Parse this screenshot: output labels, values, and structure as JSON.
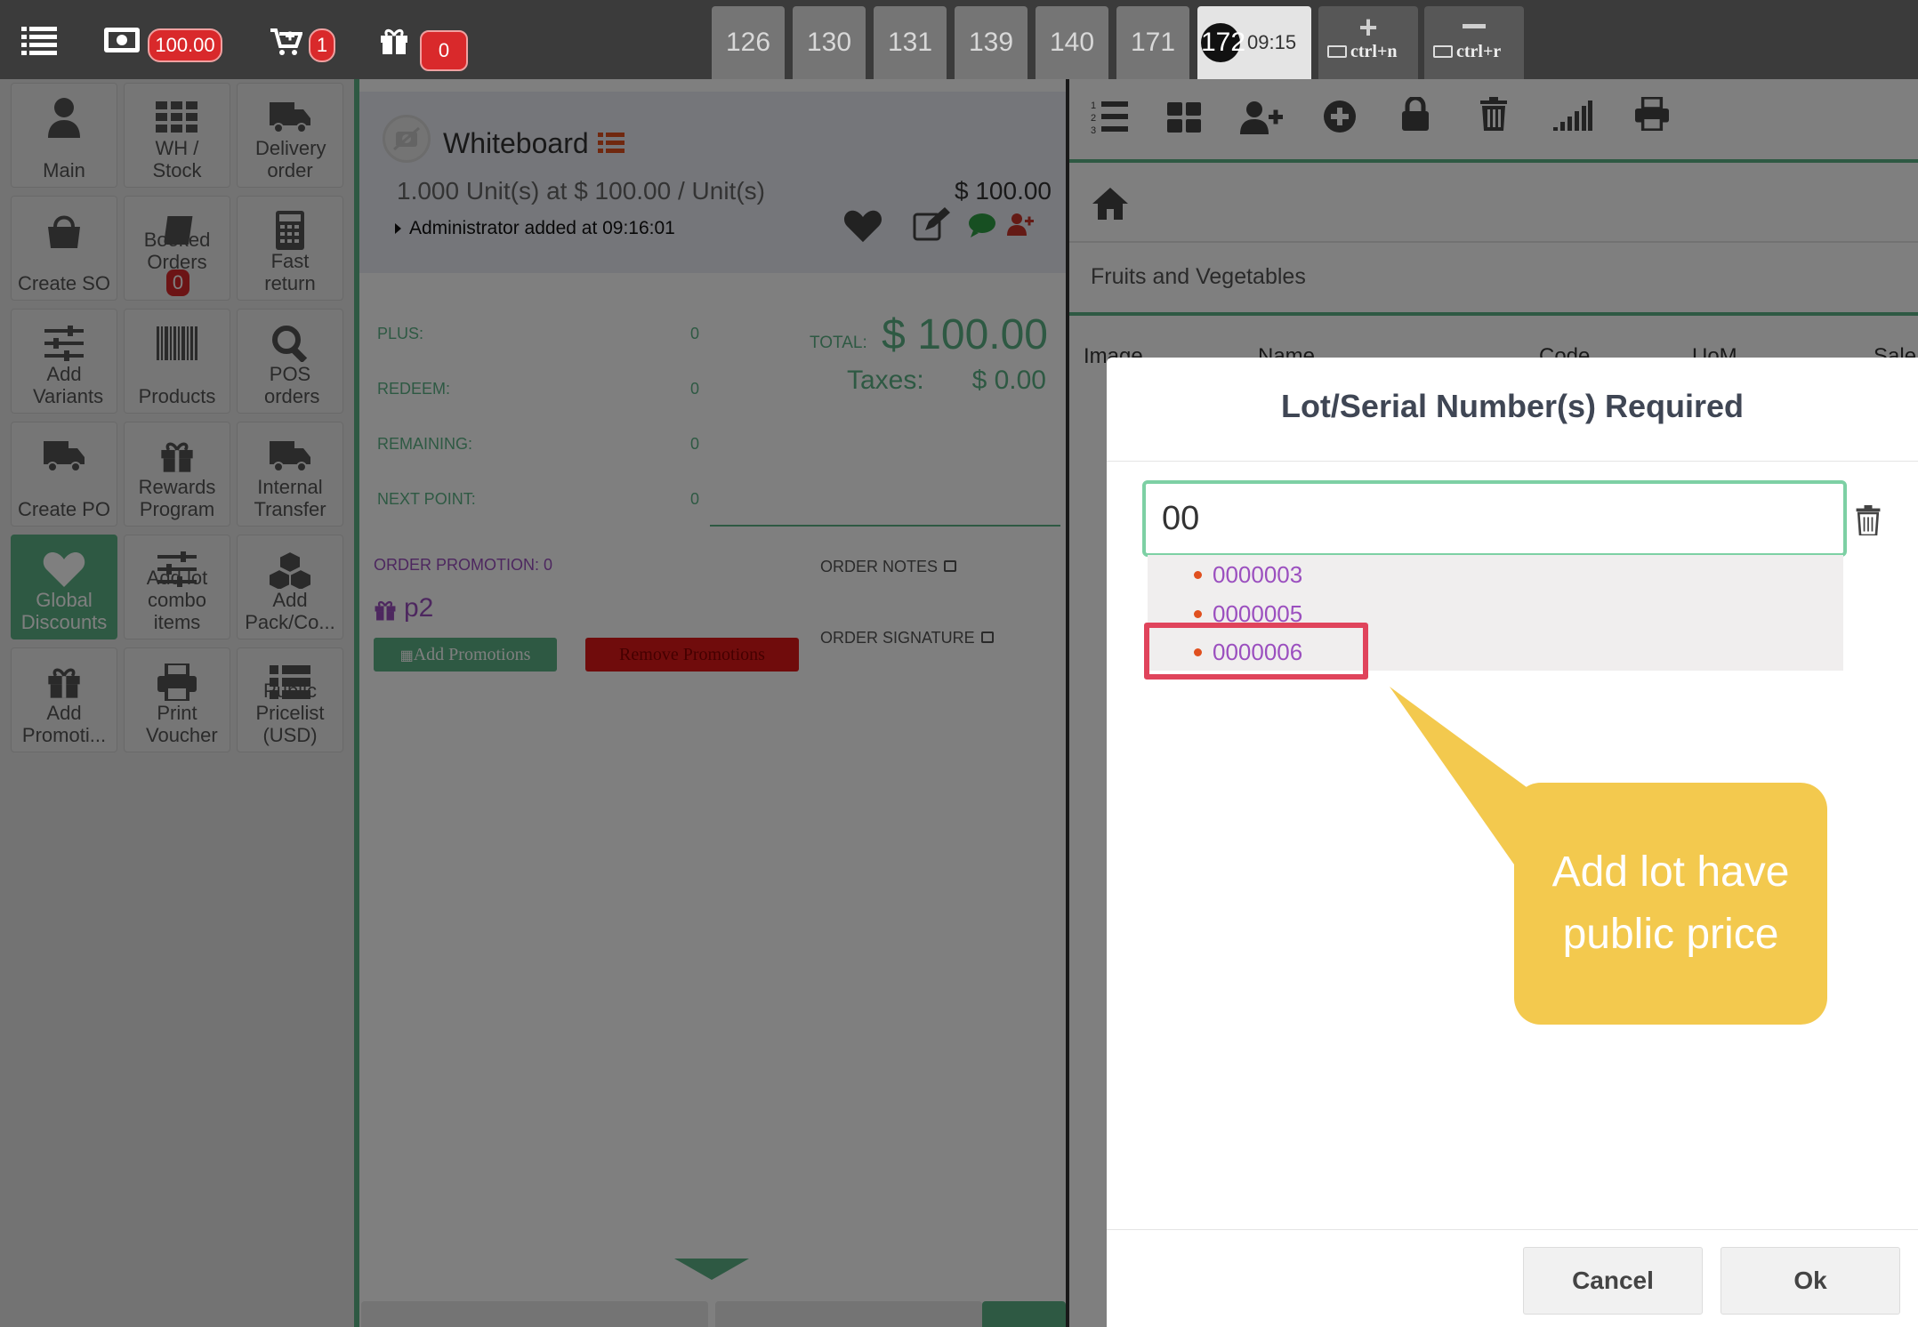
{
  "topbar": {
    "cash_amount": "100.00",
    "cart_count": "1",
    "gift_count": "0",
    "tabs": [
      "126",
      "130",
      "131",
      "139",
      "140",
      "171"
    ],
    "active_tab_number": "172",
    "active_tab_time": "09:15",
    "new_order_shortcut": "ctrl+n",
    "remove_order_shortcut": "ctrl+r"
  },
  "left_panel": {
    "buttons": [
      {
        "label": "Main",
        "icon": "user-icon"
      },
      {
        "label": "WH / Stock",
        "icon": "grid-icon"
      },
      {
        "label": "Delivery order",
        "icon": "truck-icon"
      },
      {
        "label": "Create SO",
        "icon": "shopping-bag-icon"
      },
      {
        "label": "Booked Orders",
        "icon": "book-icon",
        "badge": "0"
      },
      {
        "label": "Fast return",
        "icon": "calculator-icon"
      },
      {
        "label": "Add Variants",
        "icon": "sliders-icon"
      },
      {
        "label": "Products",
        "icon": "barcode-icon"
      },
      {
        "label": "POS orders",
        "icon": "search-icon"
      },
      {
        "label": "Create PO",
        "icon": "truck-icon"
      },
      {
        "label": "Rewards Program",
        "icon": "gift-icon"
      },
      {
        "label": "Internal Transfer",
        "icon": "truck-icon"
      },
      {
        "label": "Global Discounts",
        "icon": "heart-icon"
      },
      {
        "label": "Add lot combo items",
        "icon": "sliders-icon"
      },
      {
        "label": "Add Pack/Co...",
        "icon": "cubes-icon"
      },
      {
        "label": "Add Promoti...",
        "icon": "gift-icon"
      },
      {
        "label": "Print Voucher",
        "icon": "print-icon"
      },
      {
        "label": "Public Pricelist (USD)",
        "icon": "list-icon"
      }
    ]
  },
  "order": {
    "product_name": "Whiteboard",
    "quantity_line": "1.000 Unit(s) at $ 100.00 / Unit(s)",
    "line_price": "$ 100.00",
    "added_by": "Administrator added at 09:16:01",
    "summary": {
      "plus_label": "PLUS:",
      "plus_value": "0",
      "redeem_label": "REDEEM:",
      "redeem_value": "0",
      "remaining_label": "REMAINING:",
      "remaining_value": "0",
      "next_point_label": "NEXT POINT:",
      "next_point_value": "0",
      "total_label": "TOTAL:",
      "total_value": "$ 100.00",
      "taxes_label": "Taxes:",
      "taxes_value": "$ 0.00"
    },
    "order_promotion": "ORDER PROMOTION: 0",
    "promotion_name": "p2",
    "add_promotions_label": "Add Promotions",
    "remove_promotions_label": "Remove Promotions",
    "order_notes_label": "ORDER NOTES",
    "order_signature_label": "ORDER SIGNATURE"
  },
  "right_panel": {
    "category": "Fruits and Vegetables",
    "columns": [
      "Image",
      "Name",
      "Code",
      "UoM",
      "Sale"
    ]
  },
  "modal": {
    "title": "Lot/Serial Number(s) Required",
    "input_value": "00",
    "suggestions": [
      "0000003",
      "0000005",
      "0000006"
    ],
    "cancel_label": "Cancel",
    "ok_label": "Ok"
  },
  "callout": {
    "text": "Add lot have public price"
  },
  "colors": {
    "brand_green": "#5cb386",
    "badge_red": "#d9292b",
    "suggestion_purple": "#9b4fbf",
    "highlight_pink": "#e0445c",
    "callout_yellow": "#f3c94e"
  }
}
